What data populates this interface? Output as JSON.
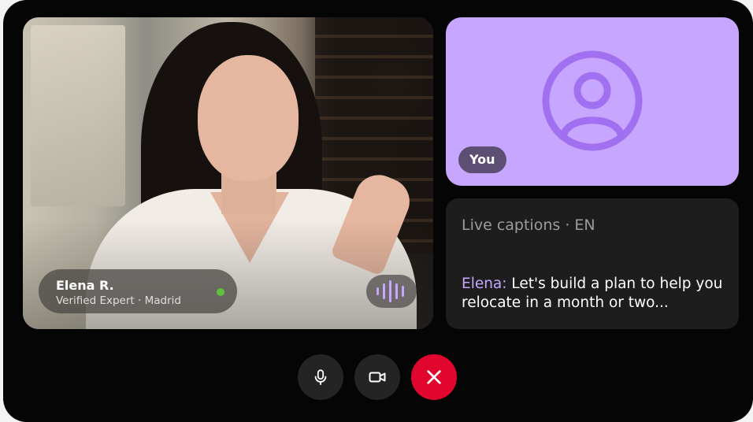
{
  "remote_participant": {
    "name": "Elena R.",
    "subtitle": "Verified Expert · Madrid",
    "status_color": "#5ec23c",
    "audio_indicator_icon": "audio-wave-icon"
  },
  "self_tile": {
    "label": "You",
    "avatar_icon": "user-circle-icon",
    "background_color": "#c6a6ff"
  },
  "captions": {
    "header": "Live captions · EN",
    "speaker": "Elena:",
    "text": "Let's build a plan to help you relocate in a month or two..."
  },
  "controls": [
    {
      "icon": "microphone-icon"
    },
    {
      "icon": "video-camera-icon"
    },
    {
      "icon": "end-call-icon",
      "color": "#e1062d"
    }
  ],
  "colors": {
    "accent": "#c6a6ff",
    "end_call": "#e1062d",
    "frame": "#050505"
  }
}
